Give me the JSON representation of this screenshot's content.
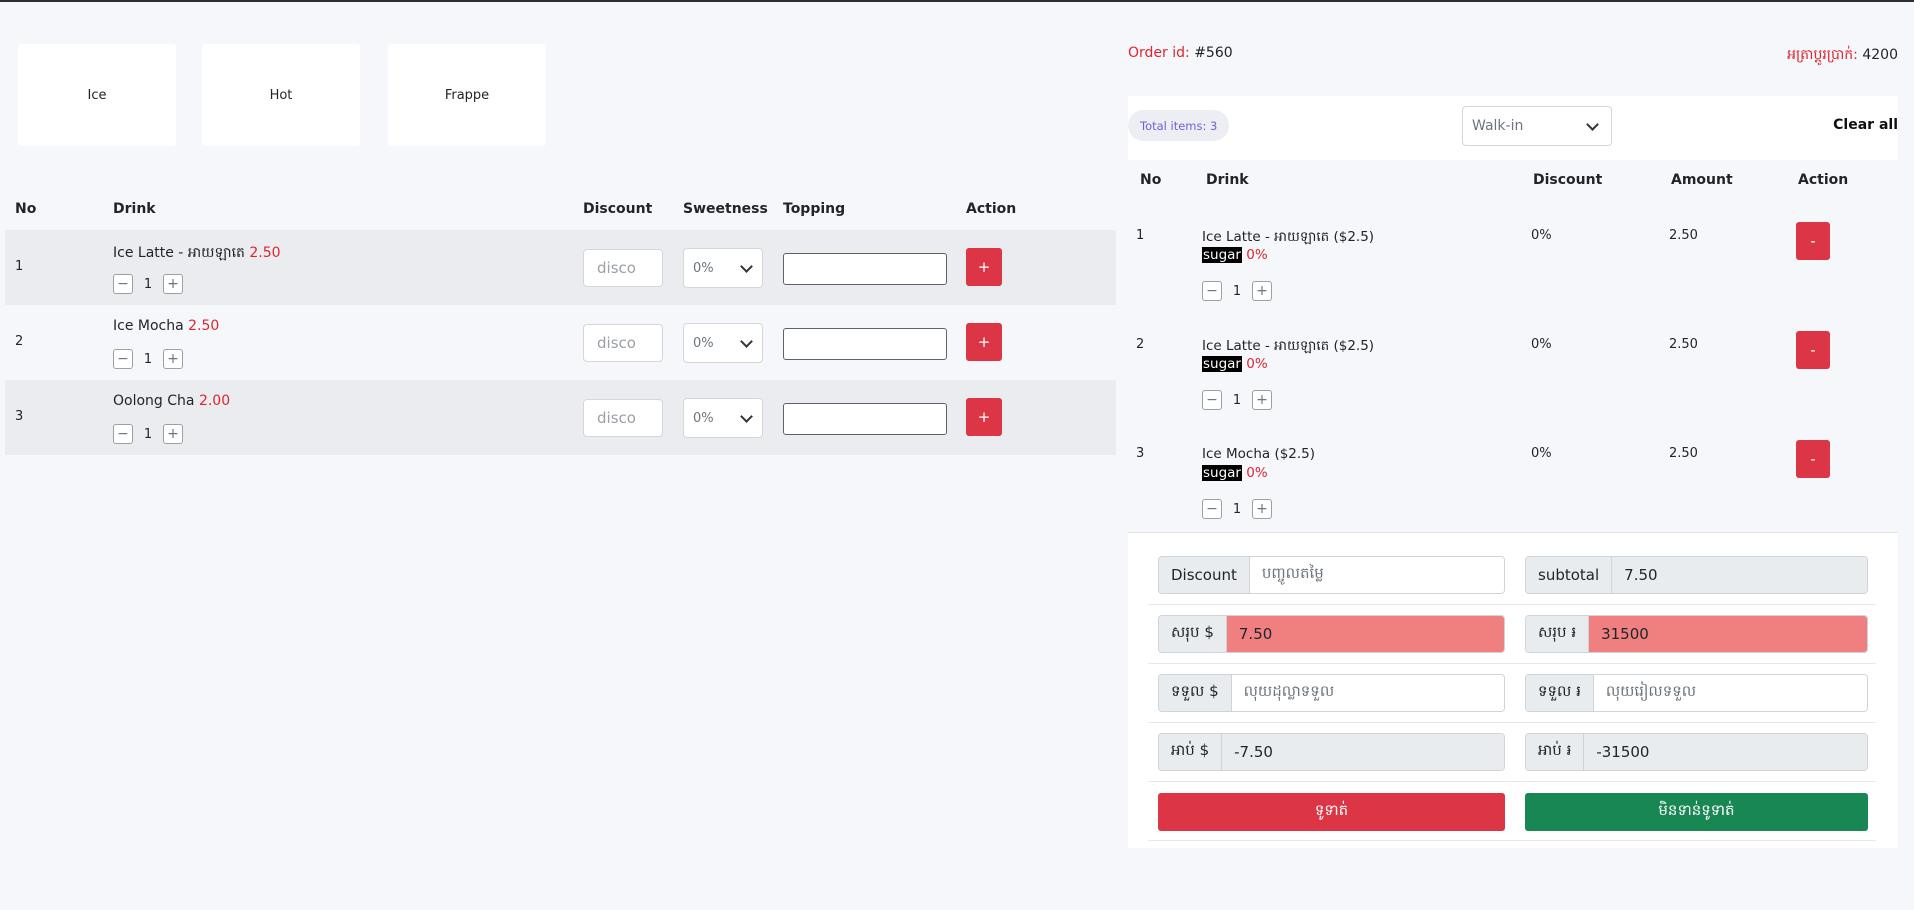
{
  "categories": [
    "Ice",
    "Hot",
    "Frappe"
  ],
  "menu_table": {
    "headers": {
      "no": "No",
      "drink": "Drink",
      "discount": "Discount",
      "sweetness": "Sweetness",
      "topping": "Topping",
      "action": "Action"
    },
    "rows": [
      {
        "no": "1",
        "name": "Ice Latte - អាយឡាតេ",
        "price": "2.50",
        "qty": "1",
        "discount_placeholder": "disco",
        "sweetness": "0%",
        "add_label": "+"
      },
      {
        "no": "2",
        "name": "Ice Mocha",
        "price": "2.50",
        "qty": "1",
        "discount_placeholder": "disco",
        "sweetness": "0%",
        "add_label": "+"
      },
      {
        "no": "3",
        "name": "Oolong Cha",
        "price": "2.00",
        "qty": "1",
        "discount_placeholder": "disco",
        "sweetness": "0%",
        "add_label": "+"
      }
    ]
  },
  "order": {
    "id_label": "Order id:",
    "id_value": "#560",
    "rate_label": "អត្រាប្តូរប្រាក់:",
    "rate_value": "4200",
    "total_items": "Total items: 3",
    "customer_type": "Walk-in",
    "clear_all": "Clear all",
    "headers": {
      "no": "No",
      "drink": "Drink",
      "discount": "Discount",
      "amount": "Amount",
      "action": "Action"
    },
    "items": [
      {
        "no": "1",
        "name": "Ice Latte - អាយឡាតេ ($2.5)",
        "sugar_label": "sugar",
        "sugar_value": "0%",
        "qty": "1",
        "discount": "0%",
        "amount": "2.50",
        "remove_label": "-"
      },
      {
        "no": "2",
        "name": "Ice Latte - អាយឡាតេ ($2.5)",
        "sugar_label": "sugar",
        "sugar_value": "0%",
        "qty": "1",
        "discount": "0%",
        "amount": "2.50",
        "remove_label": "-"
      },
      {
        "no": "3",
        "name": "Ice Mocha ($2.5)",
        "sugar_label": "sugar",
        "sugar_value": "0%",
        "qty": "1",
        "discount": "0%",
        "amount": "2.50",
        "remove_label": "-"
      }
    ]
  },
  "summary": {
    "discount_label": "Discount",
    "discount_placeholder": "បញ្ចូលតម្លៃ",
    "subtotal_label": "subtotal",
    "subtotal_value": "7.50",
    "total_usd_label": "សរុប $",
    "total_usd_value": "7.50",
    "total_khr_label": "សរុប ៛",
    "total_khr_value": "31500",
    "received_usd_label": "ទទួល $",
    "received_usd_placeholder": "លុយដុល្លាទទួល",
    "received_khr_label": "ទទួល ៛",
    "received_khr_placeholder": "លុយរៀលទទួល",
    "change_usd_label": "អាប់ $",
    "change_usd_value": "-7.50",
    "change_khr_label": "អាប់ ៛",
    "change_khr_value": "-31500",
    "pay_label": "ទូទាត់",
    "unpaid_label": "មិនទាន់ទូទាត់"
  },
  "colors": {
    "accent_red": "#dc3545",
    "price_red": "#e0242d",
    "highlight": "#f08080",
    "success": "#198754",
    "pill_text": "#6f5fe0"
  }
}
